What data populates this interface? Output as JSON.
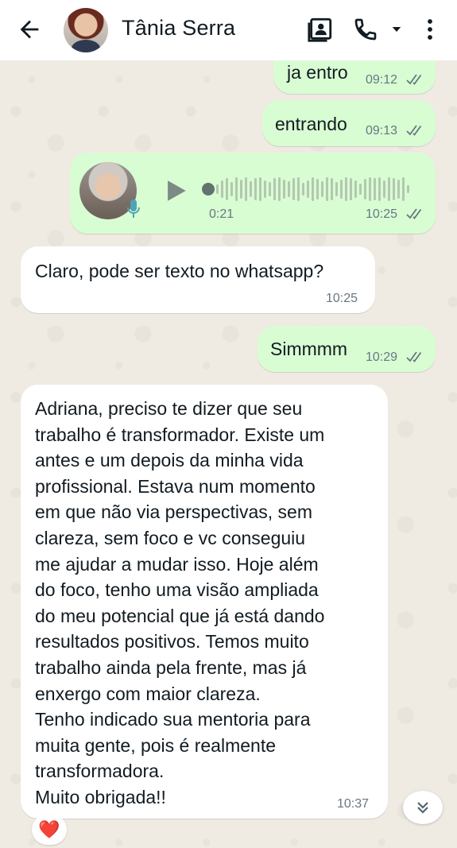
{
  "header": {
    "contact_name": "Tânia Serra",
    "icons": [
      "back-arrow-icon",
      "contact-card-icon",
      "phone-icon",
      "dropdown-icon",
      "more-options-icon"
    ]
  },
  "messages": [
    {
      "direction": "out",
      "text": "ja entro",
      "time": "09:12",
      "status": "read"
    },
    {
      "direction": "out",
      "text": "entrando",
      "time": "09:13",
      "status": "read"
    },
    {
      "direction": "out",
      "type": "voice",
      "duration": "0:21",
      "time": "10:25",
      "status": "read"
    },
    {
      "direction": "in",
      "text": "Claro, pode ser texto no whatsapp?",
      "time": "10:25"
    },
    {
      "direction": "out",
      "text": "Simmmm",
      "time": "10:29",
      "status": "read"
    },
    {
      "direction": "in",
      "time": "10:37",
      "reaction": "❤️",
      "lines": [
        "Adriana, preciso te dizer que seu",
        "trabalho é transformador. Existe um",
        "antes e um depois da minha vida",
        "profissional. Estava num momento",
        "em que não via perspectivas, sem",
        "clareza, sem foco e vc conseguiu",
        "me ajudar a mudar isso. Hoje além",
        "do foco, tenho uma visão ampliada",
        "do meu potencial que já está dando",
        "resultados positivos. Temos muito",
        "trabalho ainda pela frente, mas já",
        "enxergo com maior clareza.",
        "Tenho indicado sua mentoria para",
        "muita gente, pois é realmente",
        "transformadora.",
        "Muito obrigada!!"
      ]
    }
  ],
  "colors": {
    "outgoing_bubble": "#d9fdd3",
    "incoming_bubble": "#ffffff",
    "chat_background": "#efeae2",
    "read_ticks": "#667781"
  }
}
